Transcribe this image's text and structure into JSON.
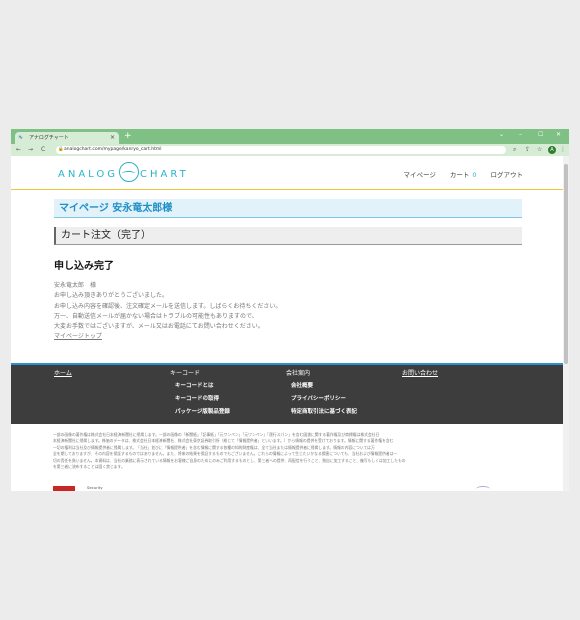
{
  "browser": {
    "tab_title": "アナログチャート",
    "favicon": "analog-chart-favicon",
    "tab_close": "×",
    "new_tab": "+",
    "nav_back": "←",
    "nav_forward": "→",
    "nav_reload": "C",
    "url": "analogchart.com/mypage/kanryo_cart.html",
    "minimize": "⌄",
    "min2": "–",
    "maximize": "☐",
    "close": "✕",
    "avatar_letter": "A"
  },
  "header": {
    "logo_left": "ANALOG",
    "logo_right": "CHART",
    "nav": {
      "mypage": "マイページ",
      "cart": "カート",
      "cart_count": "0",
      "logout": "ログアウト"
    }
  },
  "main": {
    "mypage_title": "マイページ 安永竜太郎様",
    "order_title": "カート注文（完了）",
    "done_heading": "申し込み完了",
    "message_lines": [
      "安永竜太郎　様",
      "お申し込み頂きありがとうございました。",
      "お申し込み内容を確認後、注文確定メールを送信します。しばらくお待ちください。",
      "万一、自動送信メールが届かない場合はトラブルの可能性もありますので、",
      "大変お手数ではございますが、メール又はお電話にてお問い合わせください。"
    ],
    "mypage_top_link": "マイページトップ"
  },
  "footer": {
    "home": "ホーム",
    "keycode": {
      "head": "キーコード",
      "items": [
        "キーコードとは",
        "キーコードの取得",
        "パッケージ版製品登録"
      ]
    },
    "company": {
      "head": "会社案内",
      "items": [
        "会社概要",
        "プライバシーポリシー",
        "特定商取引法に基づく表記"
      ]
    },
    "contact": "お問い合わせ"
  },
  "disclaimer_lines": [
    "一部の画像の著作権は株式会社日本経済新聞社に帰属します。一部の画像の「新聞紙」「記事紙」「元ワンペン」「元ワンペン」「運行スパン」を含む図書に関する著作権及び商標権は株式会社日",
    "本経済新聞社に帰属します。株価のデータは、株式会社日本経済新聞社、株式会社東京証券取引所（総じて「情報提供者」といいます。）から情報の提供を受けております。情報に関する著作権を含む",
    "一切の権利は当社及び情報提供者に帰属します。「当社」並びに「情報提供者」を含む情報に関する各種の知的財産権は、全て当社または情報提供者に帰属します。情報の内容については万",
    "全を期しておりますが、その内容を保証するものではありません。また、将来の結果を保証するものでもございません。これらの情報によって生じたいかなる損害についても、当社および情報提供者は一",
    "切の責任を負いません。本資料は、当社の業務に表示されている情報をお客様ご自身のためにのみご利用するものとし、第三者への提供、再配信を行うこと、独自に加工すること、複写もしくは加工したもの",
    "を第三者に流布することは固く禁じます。"
  ],
  "badge_text": "Security"
}
